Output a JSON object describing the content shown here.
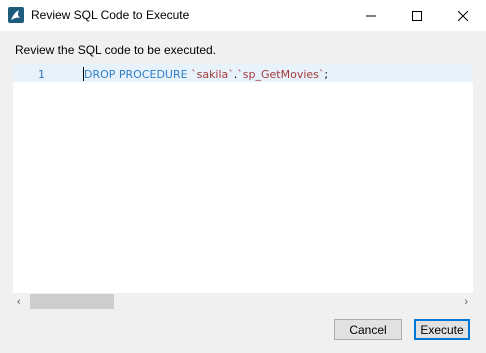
{
  "window": {
    "title": "Review SQL Code to Execute",
    "icon": "mysql-workbench-dolphin-icon",
    "controls": [
      "minimize-icon",
      "maximize-icon",
      "close-icon"
    ]
  },
  "instructions": "Review the SQL code to be executed.",
  "editor": {
    "lines": [
      {
        "number": "1",
        "tokens": [
          {
            "text": "DROP PROCEDURE",
            "type": "keyword"
          },
          {
            "text": " ",
            "type": "space"
          },
          {
            "text": "`sakila`",
            "type": "identifier"
          },
          {
            "text": ".",
            "type": "punct"
          },
          {
            "text": "`sp_GetMovies`",
            "type": "identifier"
          },
          {
            "text": ";",
            "type": "punct"
          }
        ]
      }
    ],
    "colors": {
      "keyword": "#2f7fc8",
      "identifier": "#a33a3a",
      "current_line": "#e8f2fa"
    }
  },
  "scrollbar": {
    "left_arrow": "‹",
    "right_arrow": "›"
  },
  "buttons": {
    "cancel": "Cancel",
    "execute": "Execute"
  }
}
